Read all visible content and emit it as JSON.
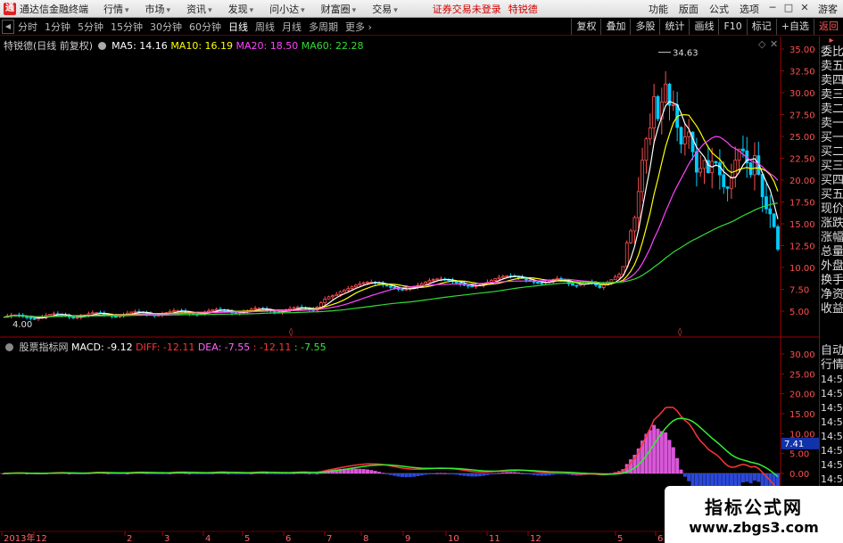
{
  "titlebar": {
    "logo": "通",
    "app_title": "通达信金融终端",
    "menus": [
      "行情",
      "市场",
      "资讯",
      "发现",
      "问小达",
      "财富圈",
      "交易"
    ],
    "notice": "证券交易未登录",
    "notice2": "特锐德",
    "right_menus": [
      "功能",
      "版面",
      "公式",
      "选项"
    ],
    "guest": "游客"
  },
  "periodbar": {
    "periods": [
      "分时",
      "1分钟",
      "5分钟",
      "15分钟",
      "30分钟",
      "60分钟",
      "日线",
      "周线",
      "月线",
      "多周期",
      "更多"
    ],
    "active_period": "日线",
    "tools": [
      "复权",
      "叠加",
      "多股",
      "统计",
      "画线",
      "F10",
      "标记",
      "+自选",
      "返回"
    ]
  },
  "main_legend": {
    "title": "特锐德(日线 前复权)",
    "ma5": "MA5: 14.16",
    "ma10": "MA10: 16.19",
    "ma20": "MA20: 18.50",
    "ma60": "MA60: 22.28"
  },
  "macd_legend": {
    "title": "股票指标网",
    "macd": "MACD: -9.12",
    "diff": "DIFF: -12.11",
    "dea": "DEA: -7.55",
    "v1": ": -12.11",
    "v2": ": -7.55"
  },
  "price_axis": [
    "35.00",
    "32.50",
    "30.00",
    "27.50",
    "25.00",
    "22.50",
    "20.00",
    "17.50",
    "15.00",
    "12.50",
    "10.00",
    "7.50",
    "5.00"
  ],
  "macd_axis": [
    "30.00",
    "25.00",
    "20.00",
    "15.00",
    "10.00",
    "5.00",
    "0.00"
  ],
  "macd_marker": "7.41",
  "annotations": {
    "high": "34.63",
    "low": "4.00"
  },
  "date_axis": [
    "2013年",
    "12",
    "2",
    "3",
    "4",
    "5",
    "6",
    "7",
    "8",
    "9",
    "10",
    "11",
    "12",
    "5",
    "6"
  ],
  "quote_column": {
    "items": [
      "委比",
      "卖五",
      "卖四",
      "卖三",
      "卖二",
      "卖一",
      "买一",
      "买二",
      "买三",
      "买四",
      "买五",
      "现价",
      "涨跌",
      "涨幅",
      "总量",
      "外盘",
      "换手",
      "净资",
      "收益"
    ],
    "items2": [
      "自动",
      "行情"
    ],
    "times": [
      "14:50",
      "14:50",
      "14:50",
      "14:50",
      "14:50",
      "14:50",
      "14:50",
      "14:50",
      "14:50",
      "14:50",
      "14:50"
    ]
  },
  "watermark": {
    "line1": "指标公式网",
    "line2": "www.zbgs3.com"
  },
  "colors": {
    "ma5": "#ffffff",
    "ma10": "#ffff00",
    "ma20": "#ff44ff",
    "ma60": "#33dd33",
    "diff": "#ff3333",
    "dea": "#33ee33",
    "macd_pos": "#ff66ff",
    "macd_neg": "#3355ff"
  }
}
